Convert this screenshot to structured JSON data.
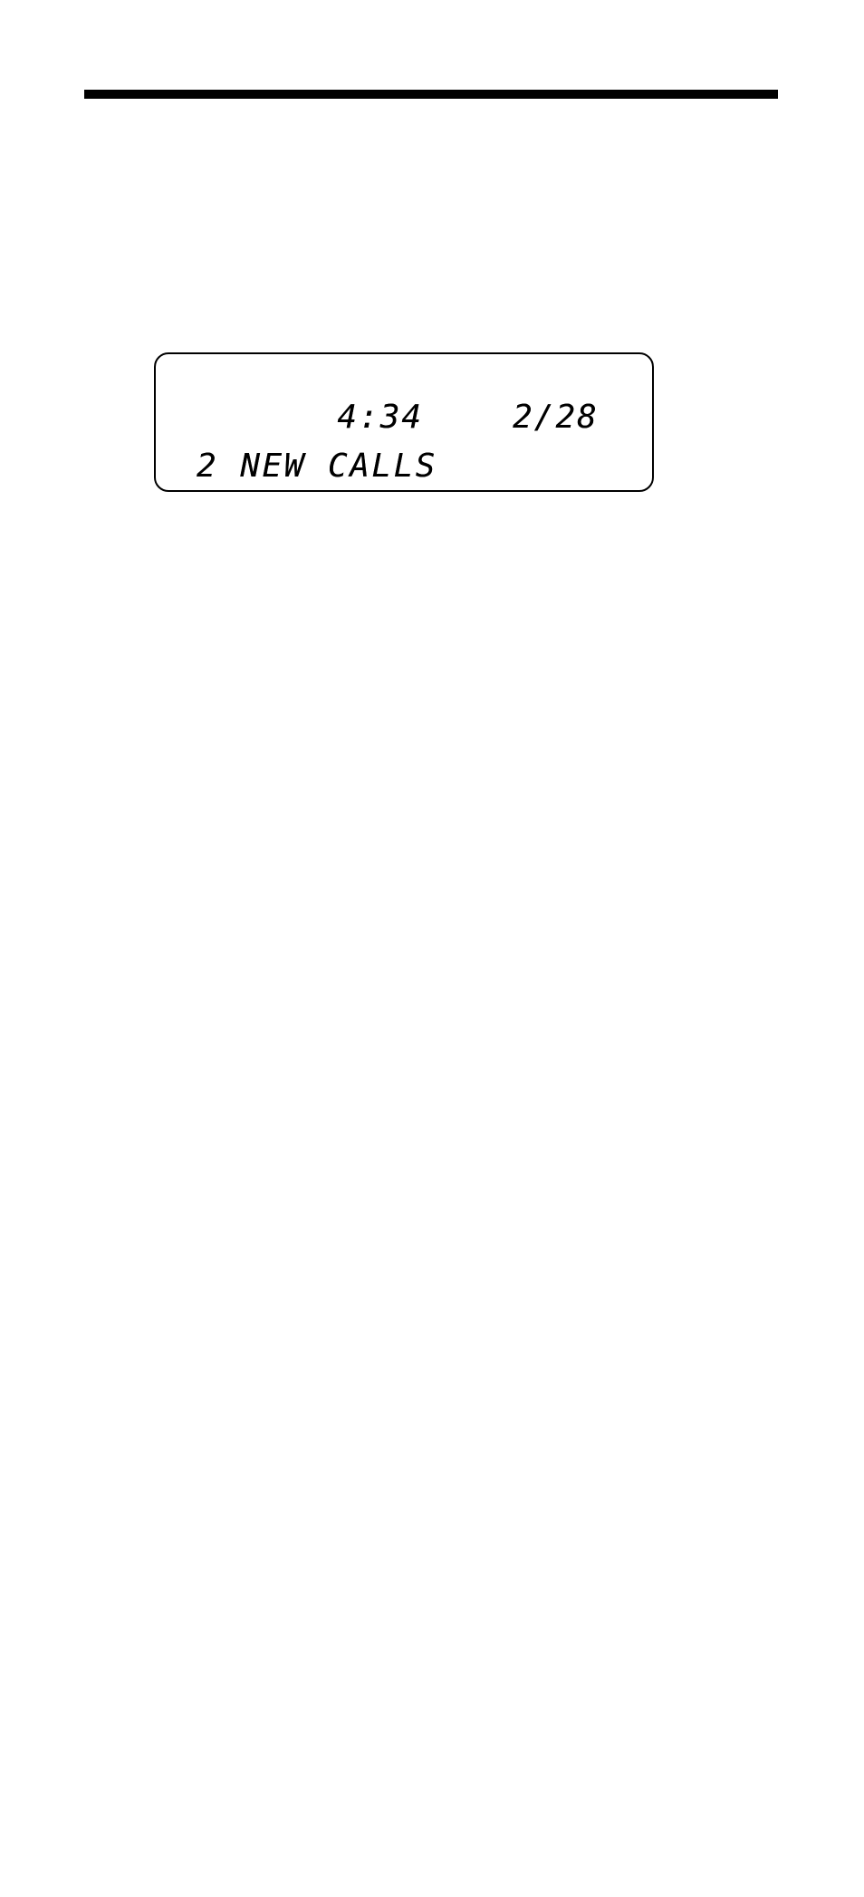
{
  "lcd": {
    "row1": {
      "time": "4:34",
      "date": "2/28"
    },
    "row2": {
      "text": "2 NEW CALLS"
    }
  }
}
